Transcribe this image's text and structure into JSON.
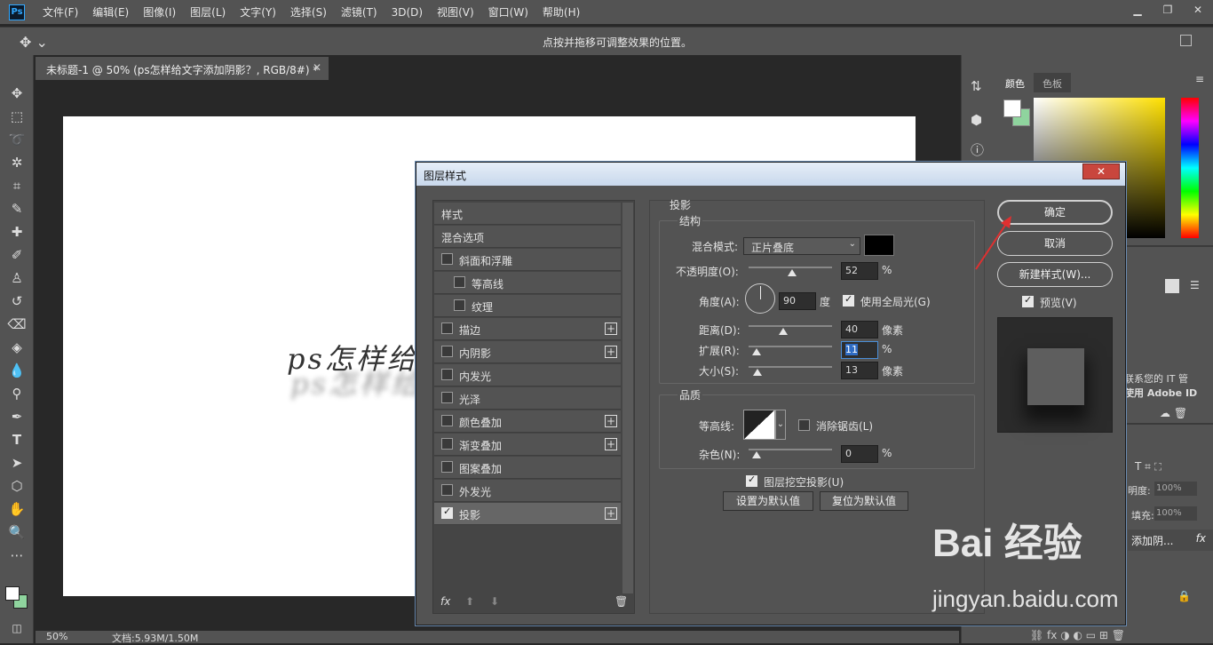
{
  "menubar": {
    "logo": "Ps",
    "items": [
      "文件(F)",
      "编辑(E)",
      "图像(I)",
      "图层(L)",
      "文字(Y)",
      "选择(S)",
      "滤镜(T)",
      "3D(D)",
      "视图(V)",
      "窗口(W)",
      "帮助(H)"
    ]
  },
  "options": {
    "hint": "点按并拖移可调整效果的位置。"
  },
  "document": {
    "tab_title": "未标题-1 @ 50% (ps怎样给文字添加阴影？, RGB/8#) *",
    "canvas_text": "ps怎样给",
    "status_zoom": "50%",
    "status_doc": "文档:5.93M/1.50M"
  },
  "right_panel": {
    "tab_color": "颜色",
    "tab_swatches": "色板",
    "bg_color": "#8fd49e",
    "partial_text_1": "联系您的 IT 管",
    "partial_text_2": "使用 Adobe ID",
    "opacity_label": "明度:",
    "opacity_value": "100%",
    "fill_label": "填充:",
    "fill_value": "100%",
    "layer_name": "添加阴...",
    "layer_fx": "fx"
  },
  "dialog": {
    "title": "图层样式",
    "close": "✕",
    "style_list": [
      {
        "label": "样式",
        "checkbox": false,
        "checked": false,
        "plus": false,
        "indent": false
      },
      {
        "label": "混合选项",
        "checkbox": false,
        "checked": false,
        "plus": false,
        "indent": false
      },
      {
        "label": "斜面和浮雕",
        "checkbox": true,
        "checked": false,
        "plus": false,
        "indent": false
      },
      {
        "label": "等高线",
        "checkbox": true,
        "checked": false,
        "plus": false,
        "indent": true
      },
      {
        "label": "纹理",
        "checkbox": true,
        "checked": false,
        "plus": false,
        "indent": true
      },
      {
        "label": "描边",
        "checkbox": true,
        "checked": false,
        "plus": true,
        "indent": false
      },
      {
        "label": "内阴影",
        "checkbox": true,
        "checked": false,
        "plus": true,
        "indent": false
      },
      {
        "label": "内发光",
        "checkbox": true,
        "checked": false,
        "plus": false,
        "indent": false
      },
      {
        "label": "光泽",
        "checkbox": true,
        "checked": false,
        "plus": false,
        "indent": false
      },
      {
        "label": "颜色叠加",
        "checkbox": true,
        "checked": false,
        "plus": true,
        "indent": false
      },
      {
        "label": "渐变叠加",
        "checkbox": true,
        "checked": false,
        "plus": true,
        "indent": false
      },
      {
        "label": "图案叠加",
        "checkbox": true,
        "checked": false,
        "plus": false,
        "indent": false
      },
      {
        "label": "外发光",
        "checkbox": true,
        "checked": false,
        "plus": false,
        "indent": false
      },
      {
        "label": "投影",
        "checkbox": true,
        "checked": true,
        "plus": true,
        "indent": false
      }
    ],
    "fx_label": "fx",
    "section_title": "投影",
    "structure_title": "结构",
    "blend_mode_label": "混合模式:",
    "blend_mode_value": "正片叠底",
    "shadow_color": "#000000",
    "opacity_label": "不透明度(O):",
    "opacity_value": "52",
    "opacity_unit": "%",
    "opacity_frac": 0.52,
    "angle_label": "角度(A):",
    "angle_value": "90",
    "angle_unit": "度",
    "global_light_label": "使用全局光(G)",
    "distance_label": "距离(D):",
    "distance_value": "40",
    "distance_unit": "像素",
    "spread_label": "扩展(R):",
    "spread_value": "11",
    "spread_unit": "%",
    "size_label": "大小(S):",
    "size_value": "13",
    "size_unit": "像素",
    "quality_title": "品质",
    "contour_label": "等高线:",
    "antialias_label": "消除锯齿(L)",
    "noise_label": "杂色(N):",
    "noise_value": "0",
    "noise_unit": "%",
    "knockout_label": "图层挖空投影(U)",
    "set_default": "设置为默认值",
    "reset_default": "复位为默认值",
    "ok": "确定",
    "cancel": "取消",
    "new_style": "新建样式(W)...",
    "preview_label": "预览(V)"
  },
  "watermark": {
    "brand": "Bai 经验",
    "url": "jingyan.baidu.com"
  }
}
